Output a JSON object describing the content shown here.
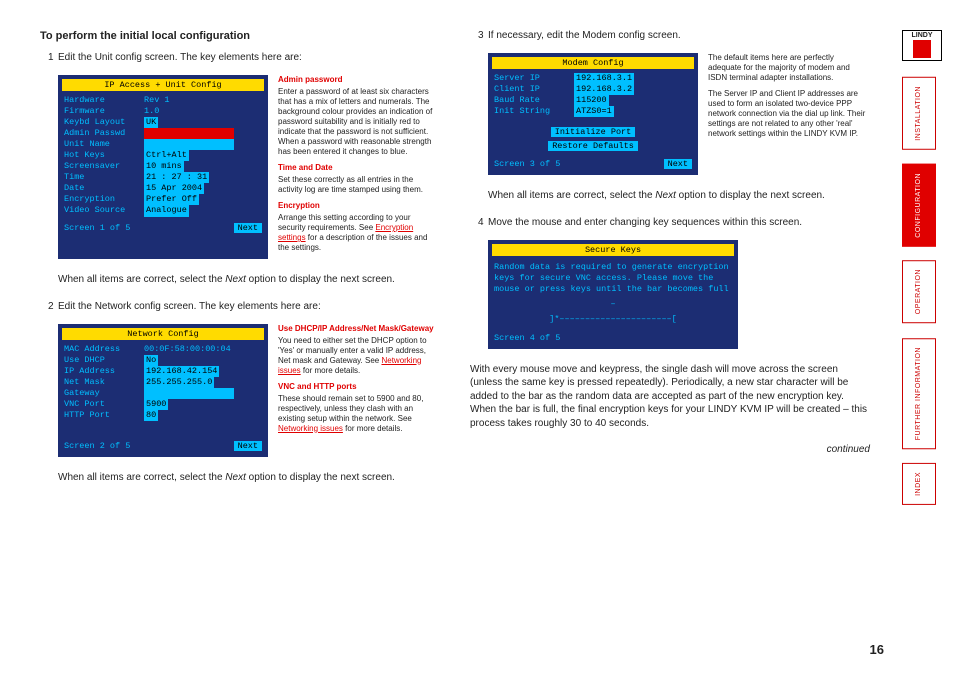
{
  "title": "To perform the initial local configuration",
  "page_number": "16",
  "continued": "continued",
  "nav": {
    "logo": "LINDY",
    "items": [
      "INSTALLATION",
      "CONFIGURATION",
      "OPERATION",
      "FURTHER INFORMATION",
      "INDEX"
    ],
    "active_index": 1
  },
  "col1": {
    "step1": {
      "num": "1",
      "text": "Edit the Unit config screen. The key elements here are:"
    },
    "term1": {
      "title": "IP Access + Unit Config",
      "rows": [
        {
          "label": "Hardware",
          "val": "Rev 1",
          "hl": ""
        },
        {
          "label": "Firmware",
          "val": "1.0",
          "hl": ""
        },
        {
          "label": "Keybd Layout",
          "val": "UK",
          "hl": "hl"
        },
        {
          "label": "Admin Passwd",
          "val": "",
          "hl": "red"
        },
        {
          "label": "Unit Name",
          "val": "",
          "hl": "hl"
        },
        {
          "label": "Hot Keys",
          "val": "Ctrl+Alt",
          "hl": "hl"
        },
        {
          "label": "Screensaver",
          "val": "10 mins",
          "hl": "hl"
        },
        {
          "label": "Time",
          "val": "21 : 27 : 31",
          "hl": "hl"
        },
        {
          "label": "Date",
          "val": "15  Apr  2004",
          "hl": "hl"
        },
        {
          "label": "Encryption",
          "val": "Prefer Off",
          "hl": "hl"
        },
        {
          "label": "Video Source",
          "val": "Analogue",
          "hl": "hl"
        }
      ],
      "footer_left": "Screen 1 of 5",
      "footer_right": "Next"
    },
    "side1": {
      "h1": "Admin password",
      "p1": "Enter a password of at least six characters that has a mix of letters and numerals. The background colour provides an indication of password suitability and is initially red to indicate that the password is not sufficient. When a password with reasonable strength has been entered it changes to blue.",
      "h2": "Time and Date",
      "p2": "Set these correctly as all entries in the activity log are time stamped using them.",
      "h3": "Encryption",
      "p3a": "Arrange this setting according to your security requirements. See ",
      "p3link": "Encryption settings",
      "p3b": " for a description of the issues and the settings."
    },
    "after1": "When all items are correct, select the Next option to display the next screen.",
    "step2": {
      "num": "2",
      "text": "Edit the Network config screen. The key elements here are:"
    },
    "term2": {
      "title": "Network Config",
      "rows": [
        {
          "label": "MAC Address",
          "val": "00:0F:58:00:00:04",
          "hl": ""
        },
        {
          "label": "Use DHCP",
          "val": "No",
          "hl": "hl"
        },
        {
          "label": "IP Address",
          "val": "192.168.42.154",
          "hl": "hl"
        },
        {
          "label": "Net Mask",
          "val": "255.255.255.0",
          "hl": "hl"
        },
        {
          "label": "Gateway",
          "val": "",
          "hl": "hl"
        },
        {
          "label": "VNC Port",
          "val": "5900",
          "hl": "hl"
        },
        {
          "label": "HTTP Port",
          "val": "80",
          "hl": "hl"
        }
      ],
      "footer_left": "Screen 2 of 5",
      "footer_right": "Next"
    },
    "side2": {
      "h1": "Use DHCP/IP Address/Net Mask/Gateway",
      "p1a": "You need to either set the DHCP option to 'Yes' or manually enter a valid IP address, Net mask and Gateway. See ",
      "p1link": "Networking issues",
      "p1b": " for more details.",
      "h2": "VNC and HTTP ports",
      "p2a": "These should remain set to 5900 and 80, respectively, unless they clash with an existing setup within the network. See ",
      "p2link": "Networking issues",
      "p2b": " for more details."
    },
    "after2": "When all items are correct, select the Next option to display the next screen."
  },
  "col2": {
    "step3": {
      "num": "3",
      "text": "If necessary, edit the Modem config screen."
    },
    "term3": {
      "title": "Modem Config",
      "rows": [
        {
          "label": "Server IP",
          "val": "192.168.3.1",
          "hl": "hl"
        },
        {
          "label": "Client IP",
          "val": "192.168.3.2",
          "hl": "hl"
        },
        {
          "label": "Baud Rate",
          "val": "115200",
          "hl": "hl"
        },
        {
          "label": "Init String",
          "val": "ATZS0=1",
          "hl": "hl"
        }
      ],
      "menu1": "Initialize Port",
      "menu2": "Restore Defaults",
      "footer_left": "Screen 3 of 5",
      "footer_right": "Next"
    },
    "side3": {
      "p1": "The default items here are perfectly adequate for the majority of modem and ISDN terminal adapter installations.",
      "p2": "The Server IP and Client IP addresses are used to form an isolated two-device PPP network connection via the dial up link. Their settings are not related to any other 'real' network settings within the LINDY KVM IP."
    },
    "after3": "When all items are correct, select the Next option to display the next screen.",
    "step4": {
      "num": "4",
      "text": "Move the mouse and enter changing key sequences within this screen."
    },
    "term4": {
      "title": "Secure Keys",
      "body": "Random data is required to generate encryption keys for secure VNC access. Please move the mouse or press keys until the bar becomes full",
      "dash": "–",
      "bar": "]*––––––––––––––––––––––[",
      "footer_left": "Screen 4 of 5"
    },
    "after4": "With every mouse move and keypress, the single dash will move across the screen (unless the same key is pressed repeatedly). Periodically, a new star character will be added to the bar as the random data are accepted as part of the new encryption key. When the bar is full, the final encryption keys for your LINDY KVM IP will be created – this process takes roughly 30 to 40 seconds."
  }
}
